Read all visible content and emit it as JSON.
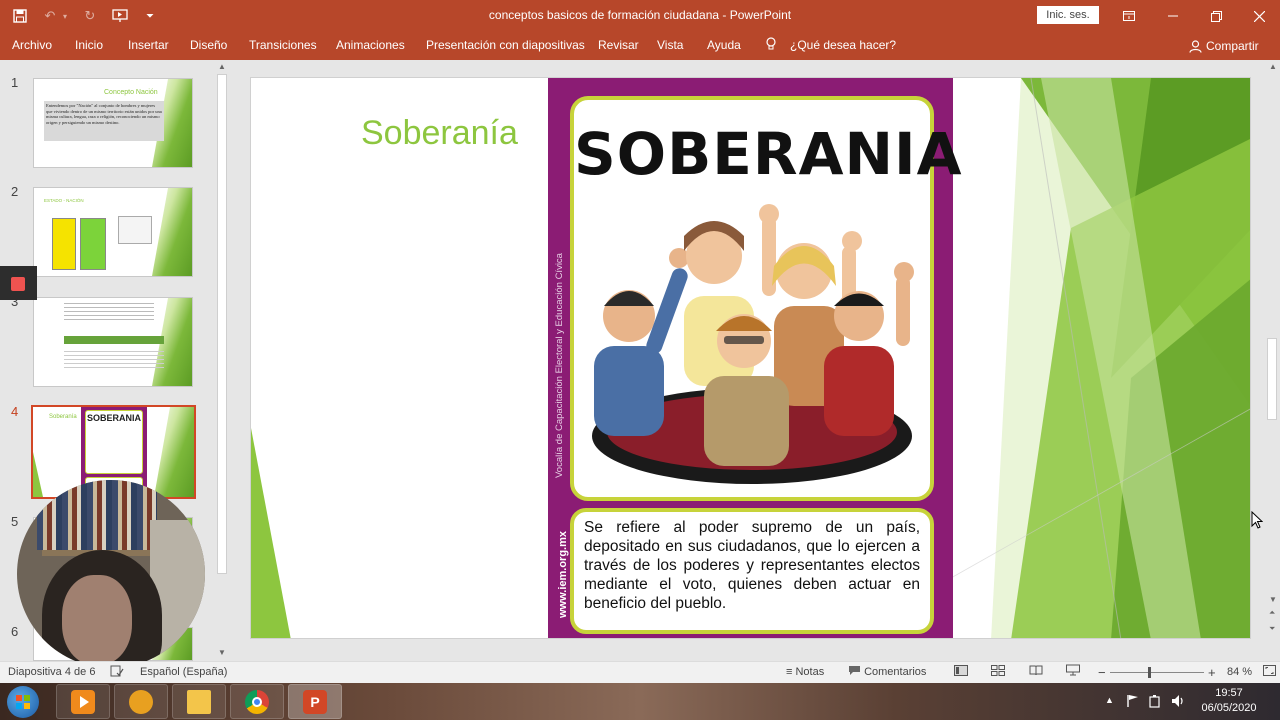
{
  "titlebar": {
    "document": "conceptos basicos  de formación ciudadana",
    "separator": " - ",
    "app": "PowerPoint",
    "signin": "Inic. ses."
  },
  "ribbon": {
    "tabs": [
      "Archivo",
      "Inicio",
      "Insertar",
      "Diseño",
      "Transiciones",
      "Animaciones",
      "Presentación con diapositivas",
      "Revisar",
      "Vista",
      "Ayuda"
    ],
    "tell_me": "¿Qué desea hacer?",
    "share": "Compartir"
  },
  "thumbnails": [
    {
      "num": "1",
      "title": "Concepto Nación",
      "text": "Entendemos por \"Nación\" al conjunto de hombres y mujeres que viviendo dentro de un mismo territorio están unidos por una misma cultura, lengua, raza o religión, reconociendo un mismo origen y persiguiendo un mismo destino."
    },
    {
      "num": "2",
      "title": "ESTADO - NACIÓN"
    },
    {
      "num": "3"
    },
    {
      "num": "4",
      "title": "Soberanía",
      "poster": "SOBERANIA"
    },
    {
      "num": "5"
    },
    {
      "num": "6"
    }
  ],
  "slide": {
    "title": "Soberanía",
    "poster_heading": "SOBERANIA",
    "poster_side": "Vocalía de Capacitación Electoral y Educación Cívica",
    "poster_url": "www.iem.org.mx",
    "poster_text": "Se refiere al poder supremo de un país, depositado en sus ciudadanos, que lo ejercen a través de los poderes y representantes electos mediante el voto, quienes deben actuar en beneficio del pueblo."
  },
  "statusbar": {
    "slide_info": "Diapositiva 4 de 6",
    "language": "Español (España)",
    "notes": "Notas",
    "comments": "Comentarios",
    "zoom": "84 %",
    "zoom_minus": "−",
    "zoom_plus": "+"
  },
  "taskbar": {
    "time": "19:57",
    "date": "06/05/2020"
  },
  "colors": {
    "accent": "#b7472a",
    "slide_green": "#8dc63f",
    "poster_purple": "#8b1c74",
    "poster_border": "#c7d33a"
  }
}
